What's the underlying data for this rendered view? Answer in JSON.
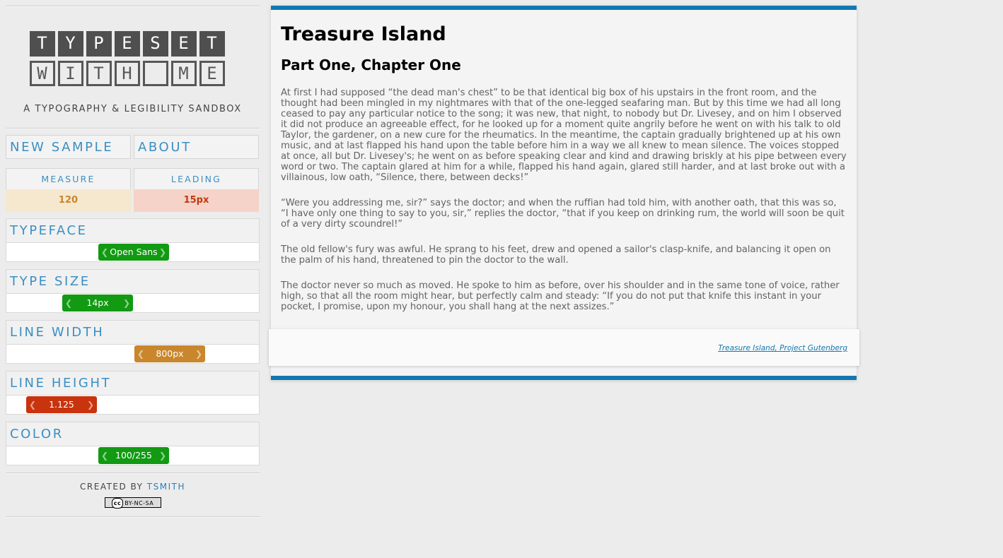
{
  "logo": {
    "row1": [
      "T",
      "Y",
      "P",
      "E",
      "S",
      "E",
      "T"
    ],
    "row2": [
      "W",
      "I",
      "T",
      "H",
      "",
      "M",
      "E"
    ]
  },
  "tagline": "A TYPOGRAPHY & LEGIBILITY SANDBOX",
  "nav": {
    "new_sample": "NEW SAMPLE",
    "about": "ABOUT"
  },
  "stats": {
    "measure_label": "MEASURE",
    "measure_value": "120",
    "leading_label": "LEADING",
    "leading_value": "15px"
  },
  "controls": {
    "typeface": {
      "label": "TYPEFACE",
      "value": "Open Sans",
      "color": "#119a12"
    },
    "type_size": {
      "label": "TYPE SIZE",
      "value": "14px",
      "color": "#119a12"
    },
    "line_width": {
      "label": "LINE WIDTH",
      "value": "800px",
      "color": "#c9862b"
    },
    "line_height": {
      "label": "LINE HEIGHT",
      "value": "1.125",
      "color": "#c9330d"
    },
    "color": {
      "label": "COLOR",
      "value": "100/255",
      "color": "#119a12"
    }
  },
  "credit": {
    "prefix": "CREATED BY ",
    "author": "TSMITH"
  },
  "license": {
    "cc": "cc",
    "text": "BY-NC-SA"
  },
  "article": {
    "title": "Treasure Island",
    "chapter": "Part One, Chapter One",
    "paragraphs": [
      "At first I had supposed “the dead man's chest” to be that identical big box of his upstairs in the front room, and the thought had been mingled in my nightmares with that of the one-legged seafaring man. But by this time we had all long ceased to pay any particular notice to the song; it was new, that night, to nobody but Dr. Livesey, and on him I observed it did not produce an agreeable effect, for he looked up for a moment quite angrily before he went on with his talk to old Taylor, the gardener, on a new cure for the rheumatics. In the meantime, the captain gradually brightened up at his own music, and at last flapped his hand upon the table before him in a way we all knew to mean silence. The voices stopped at once, all but Dr. Livesey's; he went on as before speaking clear and kind and drawing briskly at his pipe between every word or two. The captain glared at him for a while, flapped his hand again, glared still harder, and at last broke out with a villainous, low oath, “Silence, there, between decks!”",
      "“Were you addressing me, sir?” says the doctor; and when the ruffian had told him, with another oath, that this was so, “I have only one thing to say to you, sir,” replies the doctor, “that if you keep on drinking rum, the world will soon be quit of a very dirty scoundrel!”",
      "The old fellow's fury was awful. He sprang to his feet, drew and opened a sailor's clasp-knife, and balancing it open on the palm of his hand, threatened to pin the doctor to the wall.",
      "The doctor never so much as moved. He spoke to him as before, over his shoulder and in the same tone of voice, rather high, so that all the room might hear, but perfectly calm and steady: “If you do not put that knife this instant in your pocket, I promise, upon my honour, you shall hang at the next assizes.”"
    ],
    "source": "Treasure Island, Project Gutenberg"
  },
  "colors": {
    "accent": "#1278b0",
    "link": "#3b8fc2"
  }
}
